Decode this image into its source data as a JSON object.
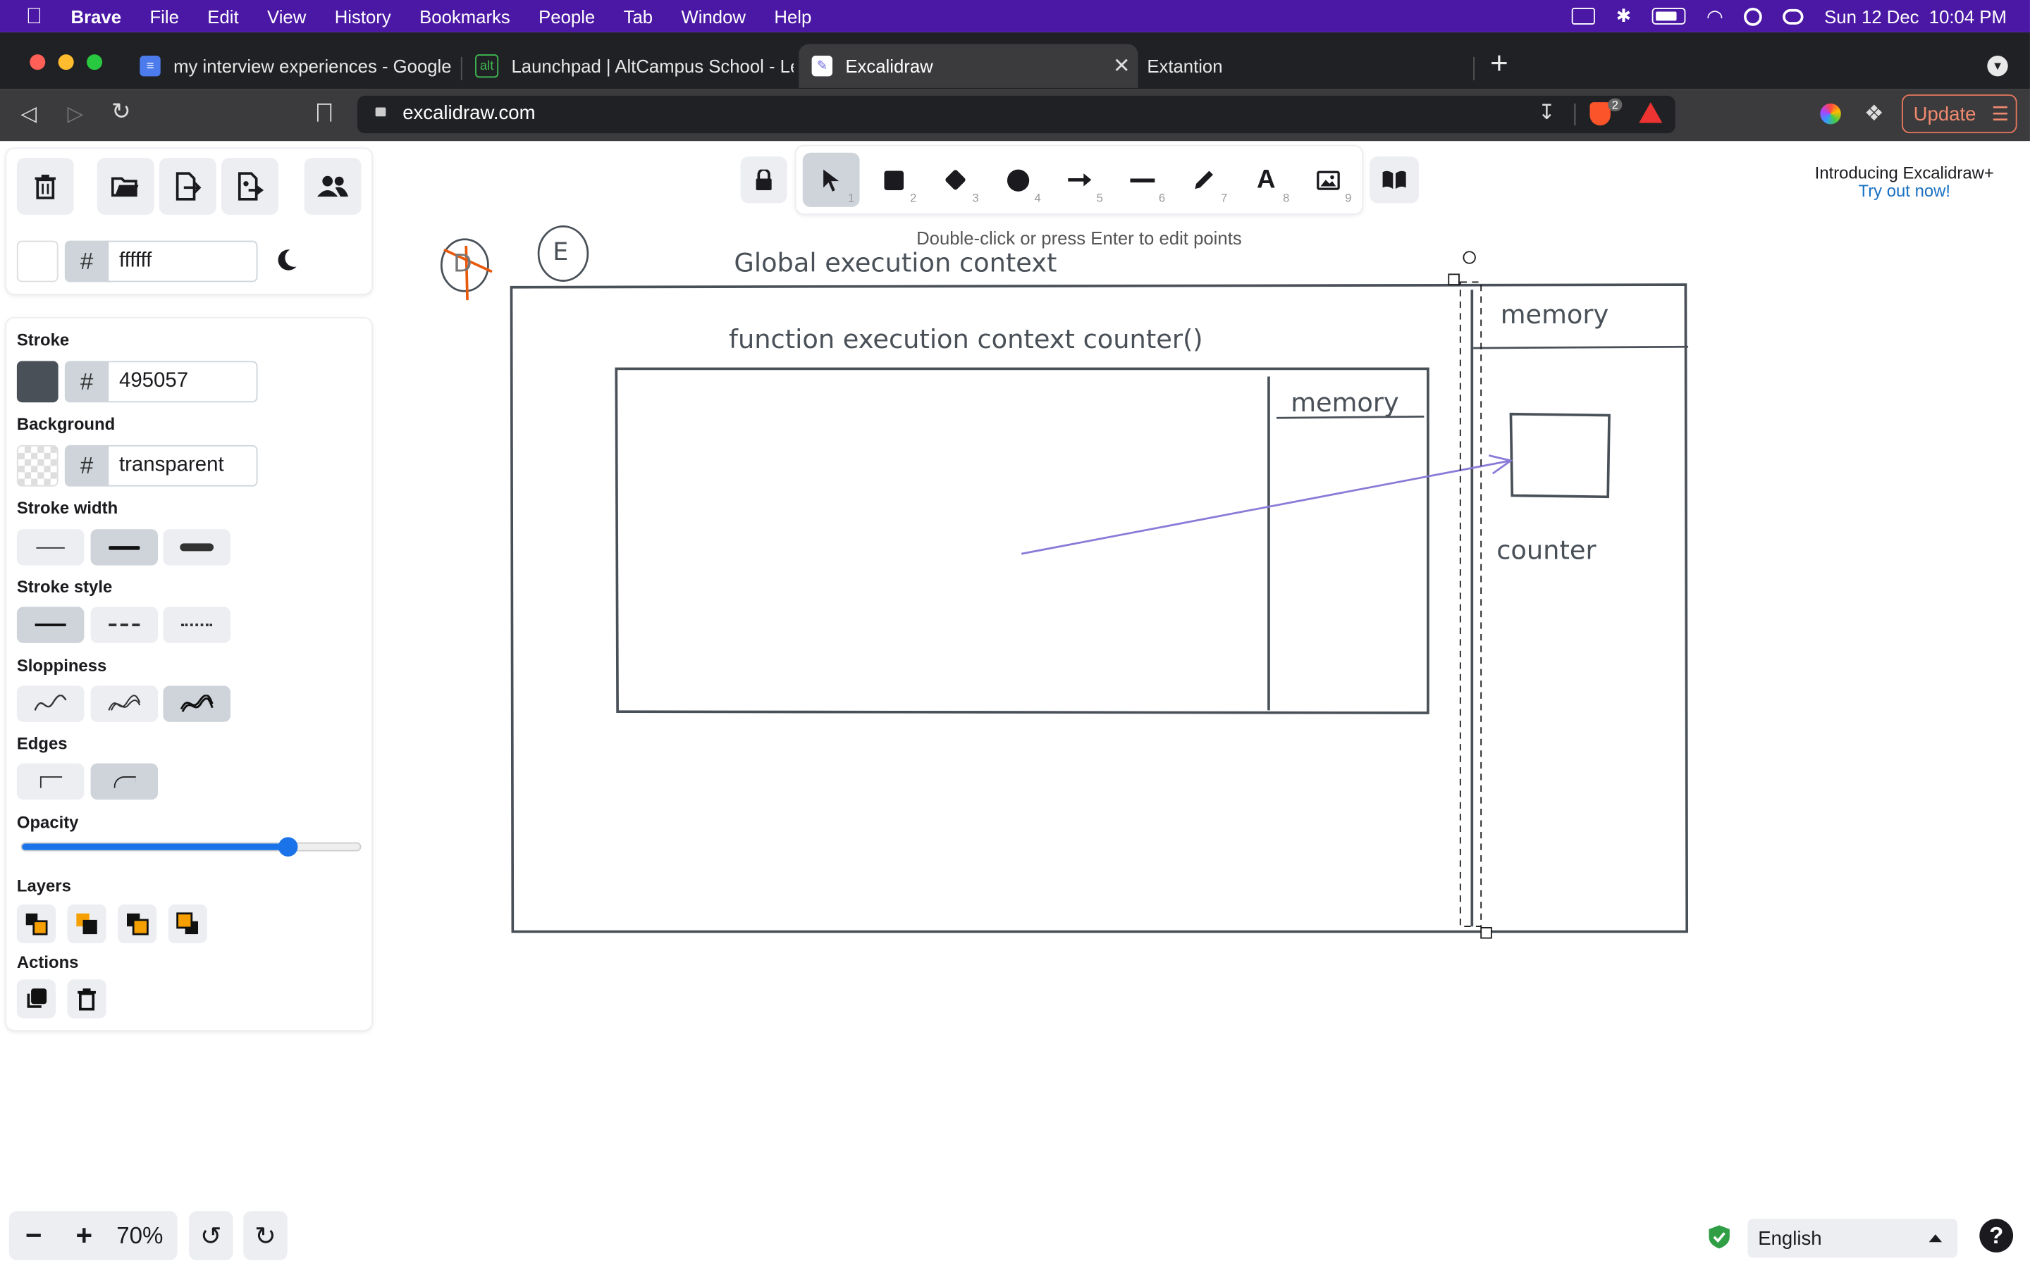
{
  "menubar": {
    "app": "Brave",
    "items": [
      "File",
      "Edit",
      "View",
      "History",
      "Bookmarks",
      "People",
      "Tab",
      "Window",
      "Help"
    ],
    "clock": "Sun 12 Dec  10:04 PM"
  },
  "tabs": [
    {
      "title": "my interview experiences - Google I"
    },
    {
      "title": "Launchpad | AltCampus School - Le"
    },
    {
      "title": "Excalidraw"
    },
    {
      "title": "Extantion"
    }
  ],
  "address": {
    "url": "excalidraw.com",
    "shield_count": "2",
    "update_label": "Update"
  },
  "sidebar": {
    "canvas_bg_hex": "ffffff",
    "stroke_label": "Stroke",
    "stroke_hex": "495057",
    "background_label": "Background",
    "background_hex": "transparent",
    "stroke_width_label": "Stroke width",
    "stroke_style_label": "Stroke style",
    "sloppiness_label": "Sloppiness",
    "edges_label": "Edges",
    "opacity_label": "Opacity",
    "opacity_value": 0.8,
    "layers_label": "Layers",
    "actions_label": "Actions",
    "hash": "#"
  },
  "toolbar": {
    "keys": [
      "1",
      "2",
      "3",
      "4",
      "5",
      "6",
      "7",
      "8",
      "9"
    ],
    "hint": "Double-click or press Enter to edit points"
  },
  "promo": {
    "title": "Introducing Excalidraw+",
    "link": "Try out now!"
  },
  "canvas": {
    "badge_d": "D",
    "badge_e": "E",
    "global_label": "Global execution context",
    "function_label": "function execution context counter()",
    "memory_inner": "memory",
    "memory_outer": "memory",
    "counter_label": "counter"
  },
  "footer": {
    "zoom": "70%",
    "language": "English",
    "help": "?"
  },
  "colors": {
    "stroke": "#495057",
    "arrow": "#8a7ad8",
    "accent": "#1971c2",
    "menubar": "#4b18a5"
  }
}
